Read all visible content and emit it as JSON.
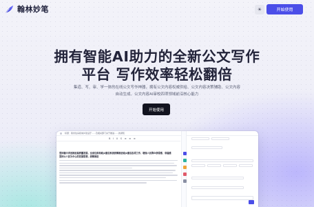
{
  "header": {
    "logo_text": "翰林妙笔",
    "theme_toggle_icon": "sun-icon",
    "start_button_label": "开始使用"
  },
  "hero": {
    "title_line1": "拥有智能AI助力的全新公文写作",
    "title_line2": "平台 写作效率轻松翻倍",
    "subtitle_line1": "集道、写、审、学一体的在线公文写作神器，拥有公文内容权威供给、公文内容决策辅助、公文内容",
    "subtitle_line2": "自动生成、公文内容AI审校四项领域前沿核心能力",
    "cta_label": "开始使用"
  },
  "mockup": {
    "window_title": "标题：我省住房和城乡建设厅……及相关部门关于推进……的通知",
    "toolbar_format": "B I U S ≡ ≡ ≡",
    "doc_heading_1": "坚持稳中求进推进高质量发展，全省住房和城乡建设系统统筹推进城乡建设各项工作，增强人民群众获得感、幸福感",
    "doc_heading_2": "坚持以人民为中心的发展思想，统筹推进"
  },
  "colors": {
    "accent": "#4b4ee8",
    "cta_dark": "#12131f",
    "title_text": "#23243a"
  }
}
